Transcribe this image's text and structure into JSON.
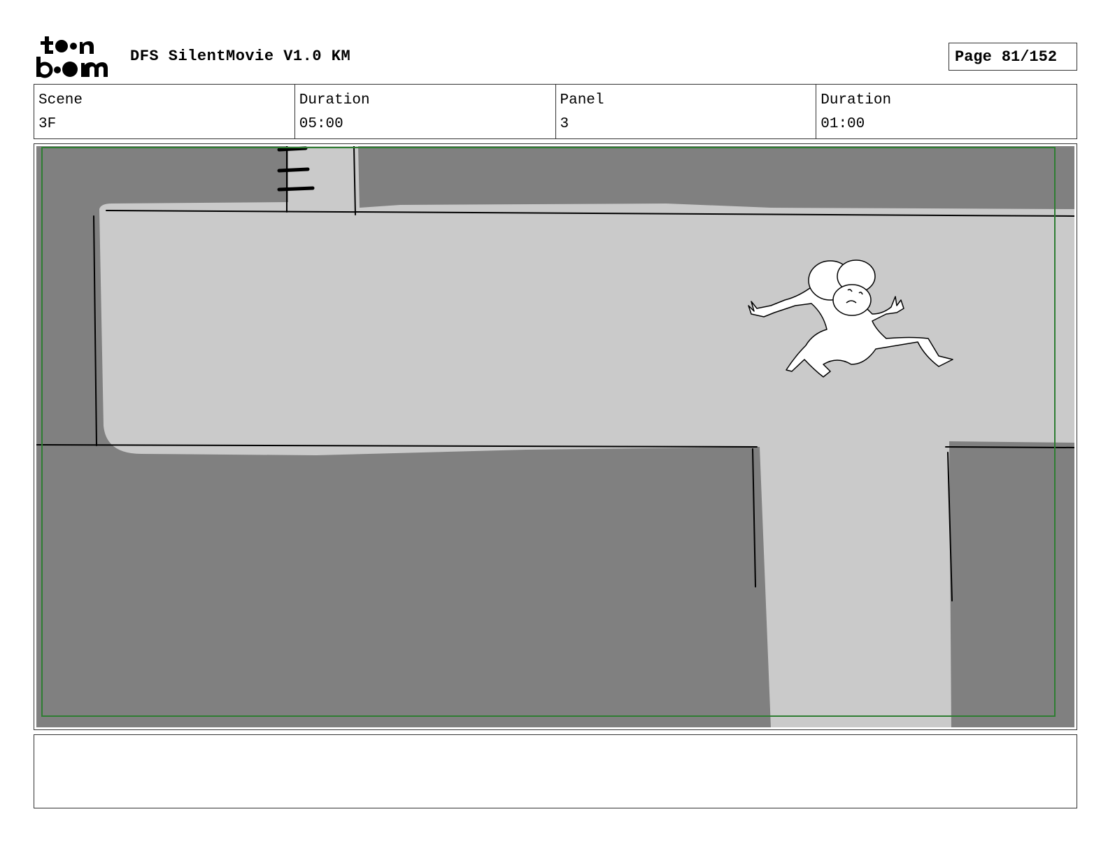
{
  "header": {
    "logo_text": "toon boom",
    "title": "DFS SilentMovie V1.0 KM",
    "page_label": "Page",
    "page_value": "81/152"
  },
  "info": [
    {
      "label": "Scene",
      "value": "3F"
    },
    {
      "label": "Duration",
      "value": "05:00"
    },
    {
      "label": "Panel",
      "value": "3"
    },
    {
      "label": "Duration",
      "value": "01:00"
    }
  ],
  "panel": {
    "safe_frame_color": "#2e7d32",
    "dark_tone": "#808080",
    "light_tone": "#cacaca",
    "figure_icon": "running-character"
  },
  "notes": ""
}
